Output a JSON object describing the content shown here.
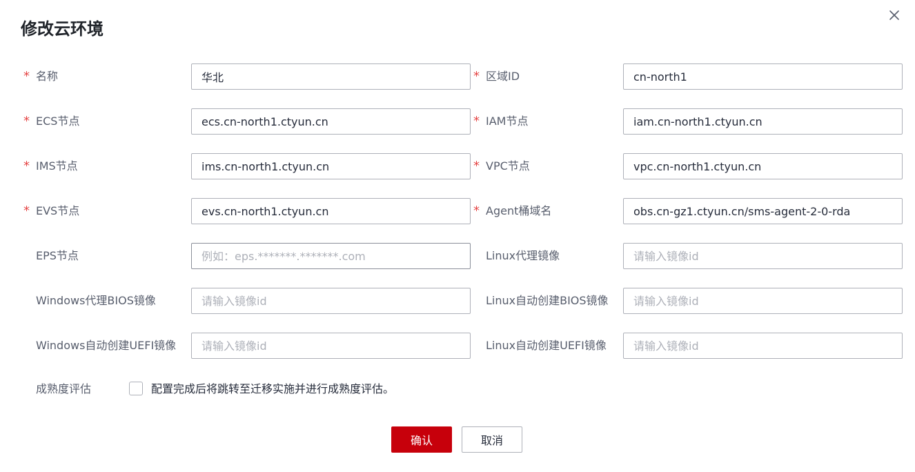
{
  "dialog": {
    "title": "修改云环境"
  },
  "form": {
    "rows": [
      {
        "left": {
          "label": "名称",
          "required": true,
          "value": "华北",
          "placeholder": ""
        },
        "right": {
          "label": "区域ID",
          "required": true,
          "value": "cn-north1",
          "placeholder": ""
        }
      },
      {
        "left": {
          "label": "ECS节点",
          "required": true,
          "value": "ecs.cn-north1.ctyun.cn",
          "placeholder": ""
        },
        "right": {
          "label": "IAM节点",
          "required": true,
          "value": "iam.cn-north1.ctyun.cn",
          "placeholder": ""
        }
      },
      {
        "left": {
          "label": "IMS节点",
          "required": true,
          "value": "ims.cn-north1.ctyun.cn",
          "placeholder": ""
        },
        "right": {
          "label": "VPC节点",
          "required": true,
          "value": "vpc.cn-north1.ctyun.cn",
          "placeholder": ""
        }
      },
      {
        "left": {
          "label": "EVS节点",
          "required": true,
          "value": "evs.cn-north1.ctyun.cn",
          "placeholder": ""
        },
        "right": {
          "label": "Agent桶域名",
          "required": true,
          "value": "obs.cn-gz1.ctyun.cn/sms-agent-2-0-rda",
          "placeholder": ""
        }
      },
      {
        "left": {
          "label": "EPS节点",
          "required": false,
          "value": "",
          "placeholder": "例如：eps.*******.*******.com"
        },
        "right": {
          "label": "Linux代理镜像",
          "required": false,
          "value": "",
          "placeholder": "请输入镜像id"
        }
      },
      {
        "left": {
          "label": "Windows代理BIOS镜像",
          "required": false,
          "value": "",
          "placeholder": "请输入镜像id"
        },
        "right": {
          "label": "Linux自动创建BIOS镜像",
          "required": false,
          "value": "",
          "placeholder": "请输入镜像id"
        }
      },
      {
        "left": {
          "label": "Windows自动创建UEFI镜像",
          "required": false,
          "value": "",
          "placeholder": "请输入镜像id"
        },
        "right": {
          "label": "Linux自动创建UEFI镜像",
          "required": false,
          "value": "",
          "placeholder": "请输入镜像id"
        }
      }
    ],
    "maturity": {
      "label": "成熟度评估",
      "checkbox_text": "配置完成后将跳转至迁移实施并进行成熟度评估。",
      "checked": false
    }
  },
  "buttons": {
    "confirm": "确认",
    "cancel": "取消"
  },
  "icons": {
    "close": "close-icon",
    "required": "*"
  },
  "colors": {
    "primary": "#c7000b",
    "required": "#e54545"
  }
}
